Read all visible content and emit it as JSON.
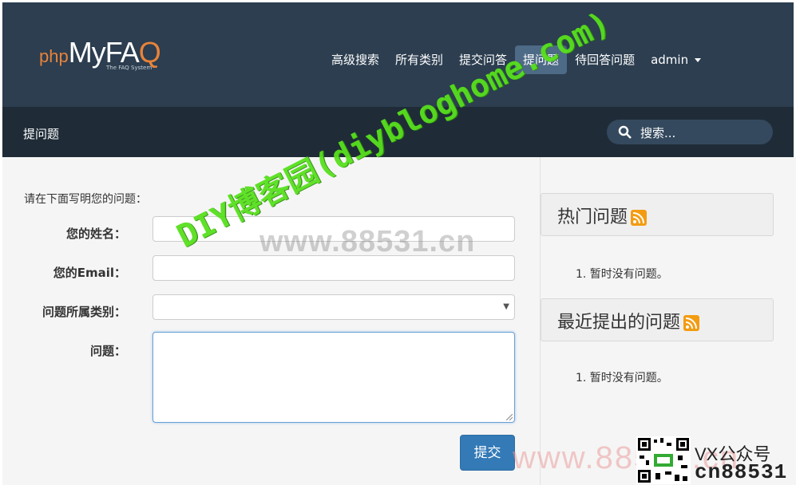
{
  "header": {
    "logo_php": "php",
    "logo_main": "MyFA",
    "logo_q": "Q",
    "logo_tagline": "The FAQ System",
    "nav": [
      "高级搜索",
      "所有类别",
      "提交问答",
      "提问题",
      "待回答问题"
    ],
    "active_nav": "提问题",
    "user": "admin"
  },
  "subheader": {
    "title": "提问题",
    "search_placeholder": "搜索..."
  },
  "form": {
    "intro": "请在下面写明您的问题：",
    "name_label": "您的姓名：",
    "email_label": "您的Email：",
    "category_label": "问题所属类别：",
    "question_label": "问题：",
    "name_value": "",
    "email_value": "",
    "category_value": "",
    "question_value": "",
    "submit_label": "提交"
  },
  "sidebar": {
    "popular_title": "热门问题",
    "popular_items": [
      "1. 暂时没有问题。"
    ],
    "recent_title": "最近提出的问题",
    "recent_items": [
      "1. 暂时没有问题。"
    ]
  },
  "watermarks": {
    "diag": "DIY博客园(diybloghome.com)",
    "grey": "www.88531.cn",
    "pink": "www.88531.cn",
    "vx": "VX公众号",
    "cn": "cn88531"
  },
  "colors": {
    "topbar": "#2c3e50",
    "subbar": "#1f2c38",
    "accent": "#e8833a",
    "button": "#337ab7",
    "rss": "#f39c12"
  }
}
